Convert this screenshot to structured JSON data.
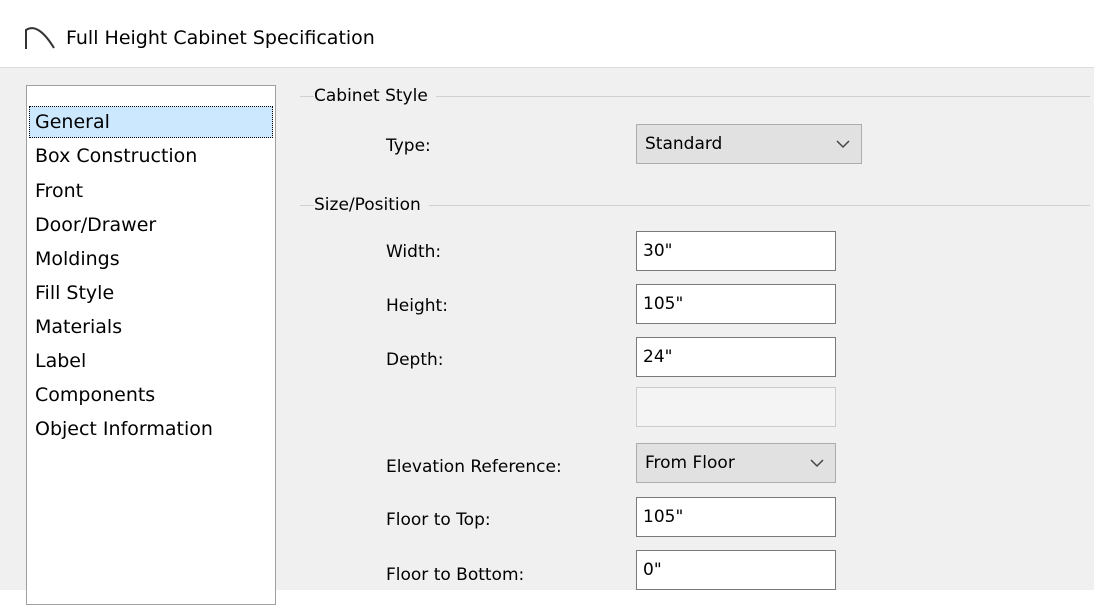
{
  "window": {
    "title": "Full Height Cabinet Specification",
    "icon": "arch-icon"
  },
  "sidebar": {
    "items": [
      {
        "label": "General",
        "selected": true
      },
      {
        "label": "Box Construction",
        "selected": false
      },
      {
        "label": "Front",
        "selected": false
      },
      {
        "label": "Door/Drawer",
        "selected": false
      },
      {
        "label": "Moldings",
        "selected": false
      },
      {
        "label": "Fill Style",
        "selected": false
      },
      {
        "label": "Materials",
        "selected": false
      },
      {
        "label": "Label",
        "selected": false
      },
      {
        "label": "Components",
        "selected": false
      },
      {
        "label": "Object Information",
        "selected": false
      }
    ]
  },
  "cabinet_style": {
    "group_label": "Cabinet Style",
    "type_label": "Type:",
    "type_value": "Standard"
  },
  "size_position": {
    "group_label": "Size/Position",
    "width_label": "Width:",
    "width_value": "30\"",
    "height_label": "Height:",
    "height_value": "105\"",
    "depth_label": "Depth:",
    "depth_value": "24\"",
    "blank_value": "",
    "elevation_label": "Elevation Reference:",
    "elevation_value": "From Floor",
    "floor_to_top_label": "Floor to Top:",
    "floor_to_top_value": "105\"",
    "floor_to_bottom_label": "Floor to Bottom:",
    "floor_to_bottom_value": "0\""
  },
  "colors": {
    "selection": "#cce8ff",
    "dialog_bg": "#f0f0f0"
  }
}
